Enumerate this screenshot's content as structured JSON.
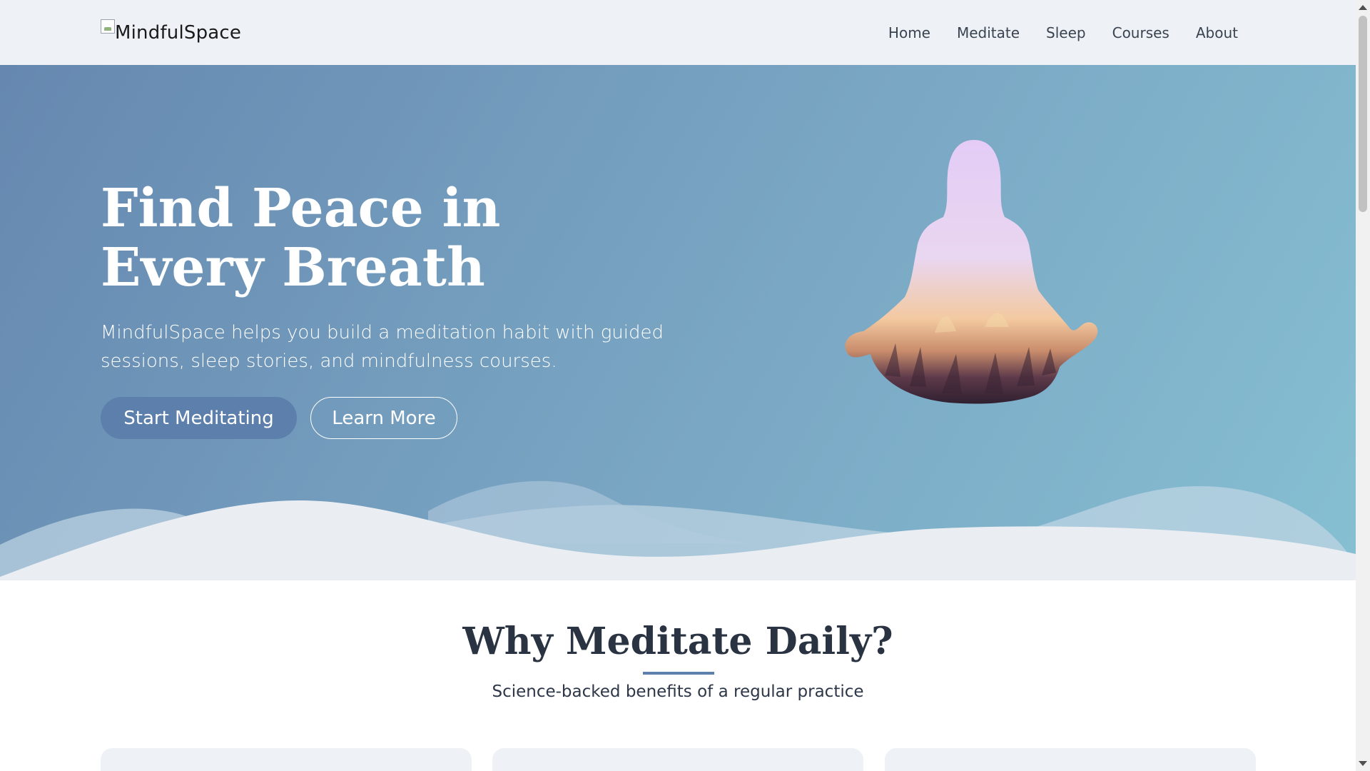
{
  "header": {
    "logo_text": "MindfulSpace",
    "nav": [
      "Home",
      "Meditate",
      "Sleep",
      "Courses",
      "About"
    ]
  },
  "hero": {
    "title": "Find Peace in Every Breath",
    "subtitle": "MindfulSpace helps you build a meditation habit with guided sessions, sleep stories, and mindfulness courses.",
    "primary_button": "Start Meditating",
    "secondary_button": "Learn More"
  },
  "section": {
    "title": "Why Meditate Daily?",
    "subtitle": "Science-backed benefits of a regular practice"
  },
  "colors": {
    "accent": "#5d7fab",
    "header_bg": "#eef2f6",
    "hero_gradient_start": "#6688b0",
    "hero_gradient_end": "#86bfd2"
  }
}
